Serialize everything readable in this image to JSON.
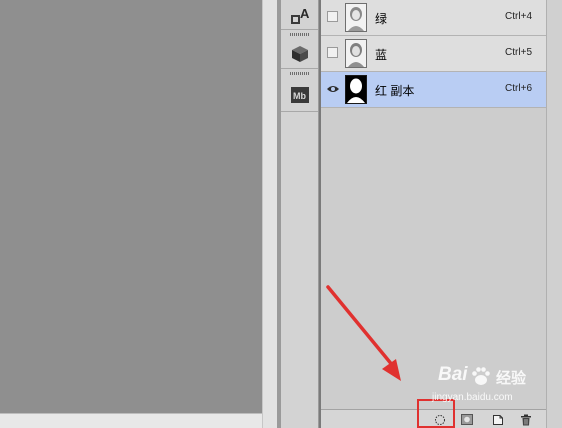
{
  "channels": [
    {
      "name": "绿",
      "shortcut": "Ctrl+4",
      "visible": false,
      "selected": false
    },
    {
      "name": "蓝",
      "shortcut": "Ctrl+5",
      "visible": false,
      "selected": false
    },
    {
      "name": "红 副本",
      "shortcut": "Ctrl+6",
      "visible": true,
      "selected": true
    }
  ],
  "dock": {
    "tools": [
      {
        "icon": "character-panel-icon",
        "label": "A"
      },
      {
        "icon": "3d-cube-icon",
        "label": ""
      },
      {
        "icon": "mini-bridge-icon",
        "label": "Mb"
      }
    ]
  },
  "bottom_bar": {
    "buttons": [
      {
        "icon": "load-channel-as-selection-icon"
      },
      {
        "icon": "save-selection-as-channel-icon"
      },
      {
        "icon": "new-channel-icon"
      },
      {
        "icon": "delete-channel-icon"
      }
    ]
  },
  "annotation": {
    "color": "#e0312f"
  },
  "watermark": {
    "brand": "Bai",
    "brand_tail": "经验",
    "url": "jingyan.baidu.com"
  },
  "colors": {
    "selected_row": "#b9cdf3",
    "canvas_bg": "#8f8f8f"
  }
}
